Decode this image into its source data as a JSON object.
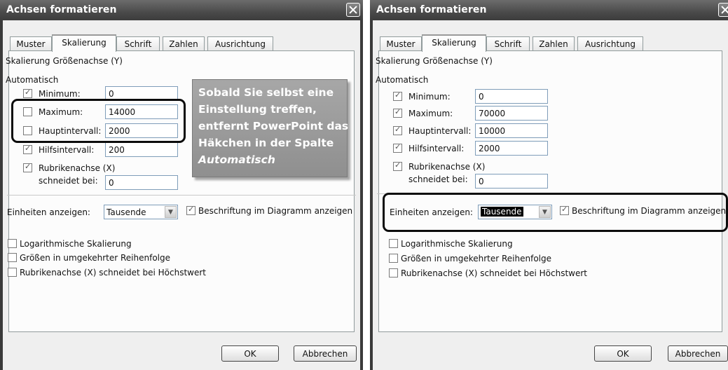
{
  "left": {
    "title": "Achsen formatieren",
    "tabs": [
      "Muster",
      "Skalierung",
      "Schrift",
      "Zahlen",
      "Ausrichtung"
    ],
    "section_title": "Skalierung Größenachse (Y)",
    "auto_label": "Automatisch",
    "rows": [
      {
        "label": "Minimum:",
        "checked": true,
        "value": "0"
      },
      {
        "label": "Maximum:",
        "checked": false,
        "value": "14000"
      },
      {
        "label": "Hauptintervall:",
        "checked": false,
        "value": "2000"
      },
      {
        "label": "Hilfsintervall:",
        "checked": true,
        "value": "200"
      }
    ],
    "rubrik_label": "Rubrikenachse (X)",
    "rubrik_sub_label": "schneidet bei:",
    "rubrik_value": "0",
    "units_label": "Einheiten anzeigen:",
    "units_value": "Tausende",
    "units_check_label": "Beschriftung im Diagramm anzeigen",
    "options": [
      "Logarithmische Skalierung",
      "Größen in umgekehrter Reihenfolge",
      "Rubrikenachse (X) schneidet bei Höchstwert"
    ],
    "ok": "OK",
    "cancel": "Abbrechen",
    "callout": {
      "line1": "Sobald Sie selbst eine",
      "line2": "Einstellung treffen,",
      "line3": "entfernt PowerPoint das",
      "line4": "Häkchen in der Spalte",
      "line5": "Automatisch"
    }
  },
  "right": {
    "title": "Achsen formatieren",
    "tabs": [
      "Muster",
      "Skalierung",
      "Schrift",
      "Zahlen",
      "Ausrichtung"
    ],
    "section_title": "Skalierung Größenachse (Y)",
    "auto_label": "Automatisch",
    "rows": [
      {
        "label": "Minimum:",
        "checked": true,
        "value": "0"
      },
      {
        "label": "Maximum:",
        "checked": true,
        "value": "70000"
      },
      {
        "label": "Hauptintervall:",
        "checked": true,
        "value": "10000"
      },
      {
        "label": "Hilfsintervall:",
        "checked": true,
        "value": "2000"
      }
    ],
    "rubrik_label": "Rubrikenachse (X)",
    "rubrik_sub_label": "schneidet bei:",
    "rubrik_value": "0",
    "units_label": "Einheiten anzeigen:",
    "units_value": "Tausende",
    "units_check_label": "Beschriftung im Diagramm anzeigen",
    "options": [
      "Logarithmische Skalierung",
      "Größen in umgekehrter Reihenfolge",
      "Rubrikenachse (X) schneidet bei Höchstwert"
    ],
    "ok": "OK",
    "cancel": "Abbrechen"
  },
  "colors": {
    "titlebar": "#4a4a4a",
    "callout": "#9a9a9a",
    "highlight": "#0c0c0c"
  }
}
